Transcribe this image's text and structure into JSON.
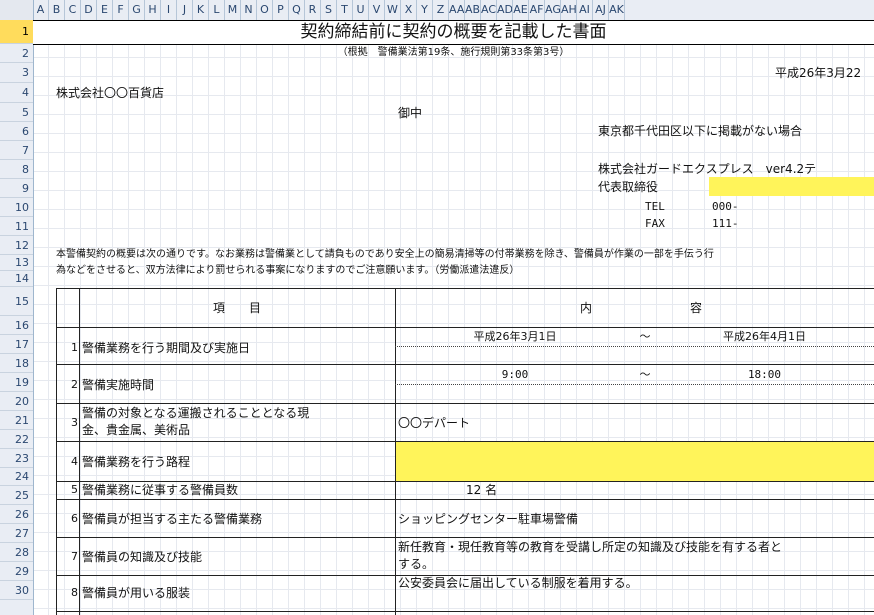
{
  "column_labels": [
    "A",
    "B",
    "C",
    "D",
    "E",
    "F",
    "G",
    "H",
    "I",
    "J",
    "K",
    "L",
    "M",
    "N",
    "O",
    "P",
    "Q",
    "R",
    "S",
    "T",
    "U",
    "V",
    "W",
    "X",
    "Y",
    "Z",
    "AA",
    "AB",
    "AC",
    "AD",
    "AE",
    "AF",
    "AG",
    "AH",
    "AI",
    "AJ",
    "AK"
  ],
  "row_labels": [
    "1",
    "2",
    "3",
    "4",
    "5",
    "6",
    "7",
    "8",
    "9",
    "10",
    "11",
    "12",
    "13",
    "14",
    "15",
    "16",
    "17",
    "18",
    "19",
    "20",
    "21",
    "22",
    "23",
    "24",
    "25",
    "26",
    "27",
    "28",
    "29",
    "30"
  ],
  "document": {
    "title": "契約締結前に契約の概要を記載した書面",
    "basis": "（根拠　警備業法第19条、施行規則第33条第3号）",
    "date": "平成26年3月22",
    "recipient": "株式会社〇〇百貨店",
    "onchu": "御中",
    "sender_address": "東京都千代田区以下に掲載がない場合",
    "sender_company": "株式会社ガードエクスプレス　ver4.2テ",
    "sender_title": "代表取締役",
    "tel_label": "TEL",
    "tel_value": "000-",
    "fax_label": "FAX",
    "fax_value": "111-",
    "notice_line1": "本警備契約の概要は次の通りです。なお業務は警備業として請負ものであり安全上の簡易清掃等の付帯業務を除き、警備員が作業の一部を手伝う行",
    "notice_line2": "為などをさせると、双方法律により罰せられる事案になりますのでご注意願います。（労働派遣法違反）"
  },
  "table": {
    "header_item": "項　　目",
    "header_content_1": "内",
    "header_content_2": "容",
    "rows": [
      {
        "no": "1",
        "item": "警備業務を行う期間及び実施日",
        "content_a": "平成26年3月1日",
        "tilde": "～",
        "content_b": "平成26年4月1日"
      },
      {
        "no": "2",
        "item": "警備実施時間",
        "content_a": "9:00",
        "tilde": "～",
        "content_b": "18:00"
      },
      {
        "no": "3",
        "item": "警備の対象となる運搬されることとなる現",
        "item2": "金、貴金属、美術品",
        "content": "〇〇デパート"
      },
      {
        "no": "4",
        "item": "警備業務を行う路程",
        "content": ""
      },
      {
        "no": "5",
        "item": "警備業務に従事する警備員数",
        "content": "12 名"
      },
      {
        "no": "6",
        "item": "警備員が担当する主たる警備業務",
        "content": "ショッピングセンター駐車場警備"
      },
      {
        "no": "7",
        "item": "警備員の知識及び技能",
        "content": "新任教育・現任教育等の教育を受講し所定の知識及び技能を有する者と",
        "content2": "する。"
      },
      {
        "no": "8",
        "item": "警備員が用いる服装",
        "content": "公安委員会に届出している制服を着用する。"
      }
    ]
  },
  "colors": {
    "highlight": "#fff45a",
    "header_bg": "#e9edf4",
    "selected_header": "#ffdc5c"
  }
}
